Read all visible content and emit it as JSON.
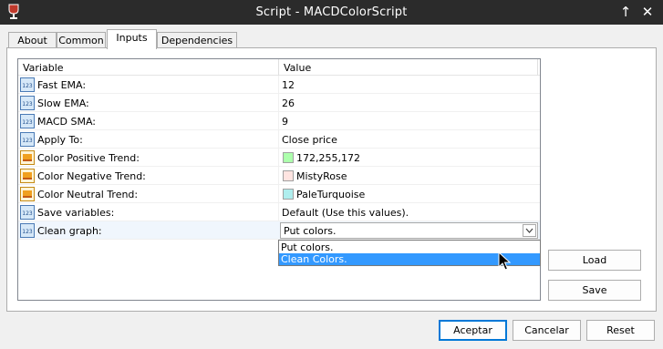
{
  "window": {
    "title": "Script - MACDColorScript",
    "pin_glyph": "↑",
    "close_glyph": "✕"
  },
  "tabs": [
    {
      "label": "About",
      "active": false
    },
    {
      "label": "Common",
      "active": false
    },
    {
      "label": "Inputs",
      "active": true
    },
    {
      "label": "Dependencies",
      "active": false
    }
  ],
  "grid": {
    "col_variable": "Variable",
    "col_value": "Value",
    "rows": [
      {
        "name": "Fast EMA:",
        "value": "12",
        "icon": "numeric-123-icon"
      },
      {
        "name": "Slow EMA:",
        "value": "26",
        "icon": "numeric-123-icon"
      },
      {
        "name": "MACD SMA:",
        "value": "9",
        "icon": "numeric-123-icon"
      },
      {
        "name": "Apply To:",
        "value": "Close price",
        "icon": "numeric-123-icon"
      },
      {
        "name": "Color Positive Trend:",
        "value": "172,255,172",
        "icon": "color-palette-icon",
        "swatch": "#acffac"
      },
      {
        "name": "Color Negative Trend:",
        "value": "MistyRose",
        "icon": "color-palette-icon",
        "swatch": "#ffe4e1"
      },
      {
        "name": "Color Neutral Trend:",
        "value": "PaleTurquoise",
        "icon": "color-palette-icon",
        "swatch": "#afeeee"
      },
      {
        "name": "Save variables:",
        "value": "Default (Use this values).",
        "icon": "numeric-123-icon"
      },
      {
        "name": "Clean graph:",
        "value": "Put colors.",
        "icon": "numeric-123-icon"
      }
    ]
  },
  "dropdown": {
    "options": [
      "Put colors.",
      "Clean Colors."
    ],
    "highlighted": "Clean Colors."
  },
  "side_buttons": {
    "load": "Load",
    "save": "Save"
  },
  "footer": {
    "accept": "Aceptar",
    "cancel": "Cancelar",
    "reset": "Reset"
  },
  "colors": {
    "titlebar_bg": "#2b2b2b",
    "selection": "#3399ff",
    "accent_border": "#0078d7"
  }
}
